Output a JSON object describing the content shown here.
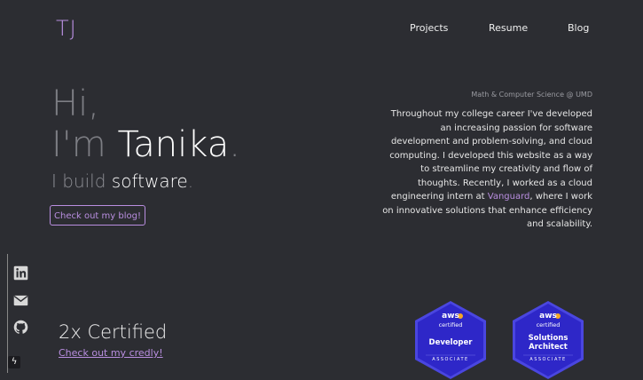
{
  "header": {
    "logo": "TJ",
    "nav": [
      "Projects",
      "Resume",
      "Blog"
    ]
  },
  "hero": {
    "hi": "Hi,",
    "im": "I'm",
    "name": "Tanika",
    "dot": ".",
    "build_prefix": "I build",
    "build_word": "software",
    "build_dot": ".",
    "blog_button": "Check out my blog!"
  },
  "about": {
    "subtitle": "Math & Computer Science @ UMD",
    "bio_part1": "Throughout my college career I've developed an increasing passion for software development and problem-solving, and cloud computing. I developed this website as a way to streamline my creativity and flow of thoughts. Recently, I worked as a cloud engineering intern at ",
    "bio_highlight": "Vanguard",
    "bio_part2": ", where I work on innovative solutions that enhance efficiency and scalability."
  },
  "social": {
    "icons": [
      "linkedin-icon",
      "mail-icon",
      "github-icon",
      "netlify-icon"
    ]
  },
  "certs": {
    "title": "2x Certified",
    "credly_link": "Check out my credly!",
    "badges": [
      {
        "aws": "aws",
        "certified": "certified",
        "role": "Developer",
        "level": "ASSOCIATE"
      },
      {
        "aws": "aws",
        "certified": "certified",
        "role": "Solutions Architect",
        "level": "ASSOCIATE"
      }
    ]
  },
  "colors": {
    "background": "#2c2d32",
    "accent": "#b98ee0",
    "badge_blue": "#2e27c8"
  }
}
